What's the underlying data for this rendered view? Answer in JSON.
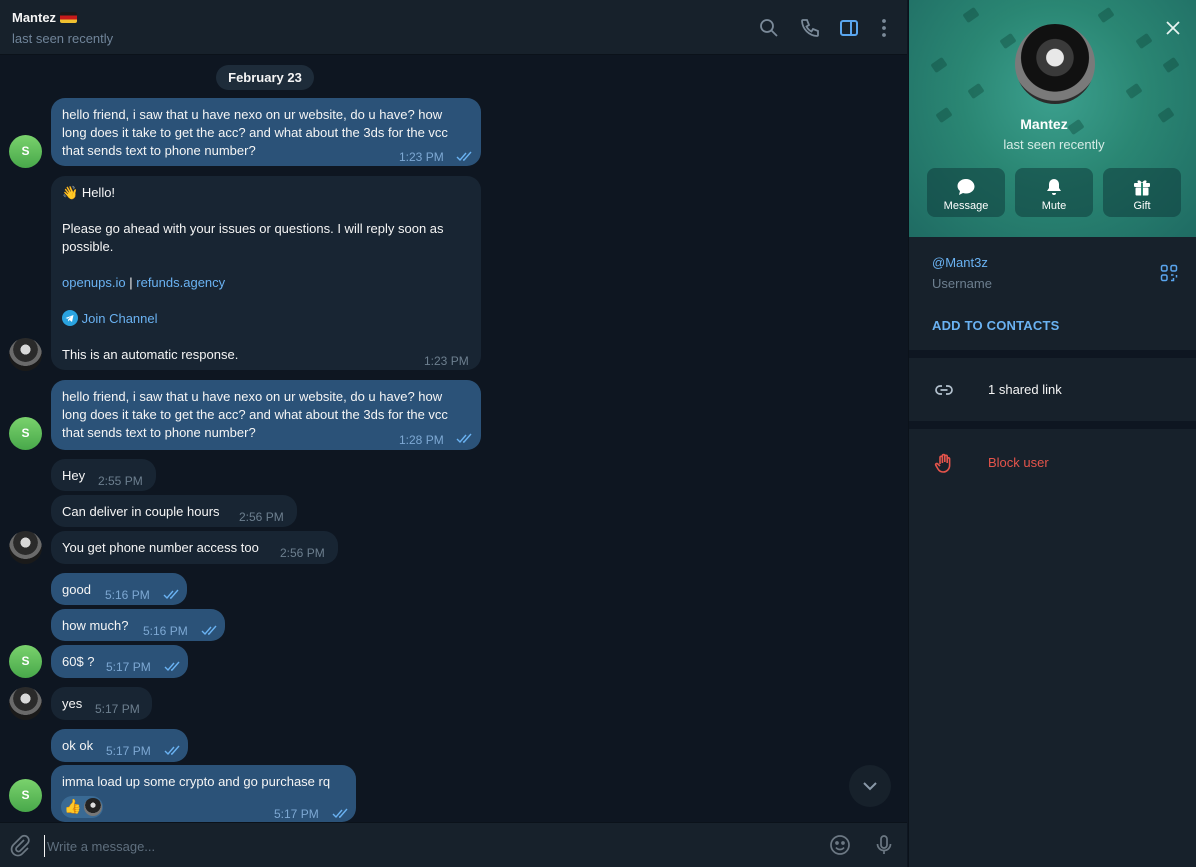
{
  "header": {
    "name": "Mantez",
    "status": "last seen recently",
    "icons": [
      "search-icon",
      "phone-icon",
      "sidebar-toggle-icon",
      "more-vertical-icon"
    ]
  },
  "date_separator": "February 23",
  "messages": [
    {
      "id": 1,
      "dir": "out",
      "lines": [
        "hello friend, i saw that u have nexo on ur website, do u have? how",
        "long does it take to get the acc? and what about the 3ds for the vcc",
        "that sends text to phone number?"
      ],
      "time": "1:23 PM",
      "read": true
    },
    {
      "id": 2,
      "dir": "in",
      "hello": "Hello!",
      "body": [
        "Please go ahead with your issues or questions. I will reply soon as",
        "possible."
      ],
      "link1": "openups.io",
      "link_sep": "|",
      "link2": "refunds.agency",
      "join": "Join Channel",
      "footer": "This is an automatic response.",
      "time": "1:23 PM"
    },
    {
      "id": 3,
      "dir": "out",
      "lines": [
        "hello friend, i saw that u have nexo on ur website, do u have? how",
        "long does it take to get the acc? and what about the 3ds for the vcc",
        "that sends text to phone number?"
      ],
      "time": "1:28 PM",
      "read": true
    },
    {
      "id": 4,
      "dir": "in",
      "text": "Hey",
      "time": "2:55 PM"
    },
    {
      "id": 5,
      "dir": "in",
      "text": "Can deliver in couple hours",
      "time": "2:56 PM"
    },
    {
      "id": 6,
      "dir": "in",
      "text": "You get phone number access too",
      "time": "2:56 PM"
    },
    {
      "id": 7,
      "dir": "out",
      "text": "good",
      "time": "5:16 PM",
      "read": true
    },
    {
      "id": 8,
      "dir": "out",
      "text": "how much?",
      "time": "5:16 PM",
      "read": true
    },
    {
      "id": 9,
      "dir": "out",
      "text": "60$ ?",
      "time": "5:17 PM",
      "read": true
    },
    {
      "id": 10,
      "dir": "in",
      "text": "yes",
      "time": "5:17 PM"
    },
    {
      "id": 11,
      "dir": "out",
      "text": "ok ok",
      "time": "5:17 PM",
      "read": true
    },
    {
      "id": 12,
      "dir": "out",
      "text": "imma load up some crypto and go purchase rq",
      "time": "5:17 PM",
      "read": true,
      "reaction": "👍"
    }
  ],
  "sender_avatar_letter": "S",
  "composer": {
    "placeholder": "Write a message..."
  },
  "profile": {
    "name": "Mantez",
    "status": "last seen recently",
    "buttons": {
      "message": "Message",
      "mute": "Mute",
      "gift": "Gift"
    },
    "username": "@Mant3z",
    "username_label": "Username",
    "add_contacts": "ADD TO CONTACTS",
    "shared_links": "1 shared link",
    "block": "Block user"
  },
  "colors": {
    "accent": "#6ab2f2",
    "out_bubble": "#2b5278",
    "in_bubble": "#182533",
    "danger": "#e5544b",
    "profile_bg": "#2a8673"
  }
}
